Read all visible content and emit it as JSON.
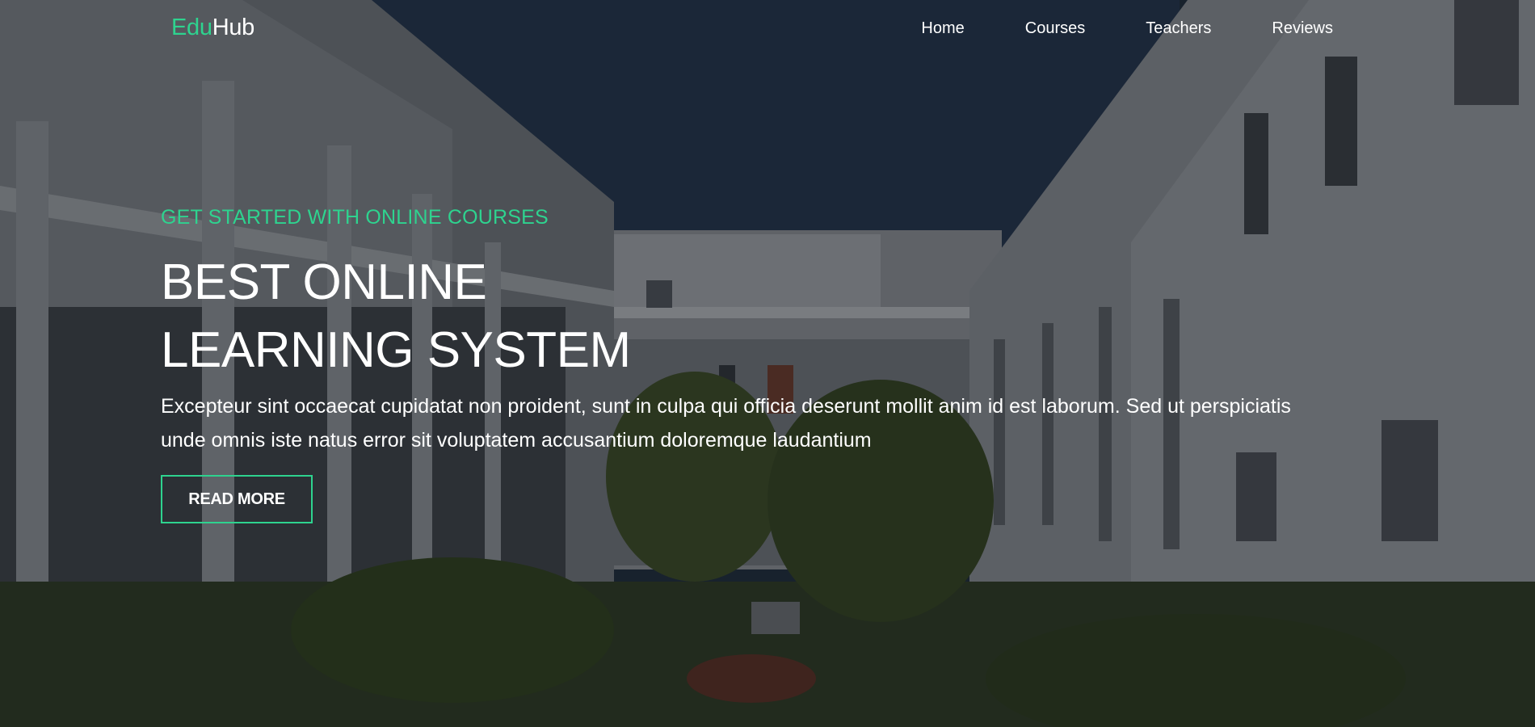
{
  "brand": {
    "logo_part1": "Edu",
    "logo_part2": "Hub",
    "accent_color": "#2ed38f"
  },
  "nav": {
    "items": [
      {
        "label": "Home"
      },
      {
        "label": "Courses"
      },
      {
        "label": "Teachers"
      },
      {
        "label": "Reviews"
      }
    ]
  },
  "hero": {
    "kicker": "GET STARTED WITH ONLINE COURSES",
    "headline_line1": "BEST ONLINE",
    "headline_line2": "LEARNING SYSTEM",
    "description": "Excepteur sint occaecat cupidatat non proident, sunt in culpa qui officia deserunt mollit anim id est laborum. Sed ut perspiciatis unde omnis iste natus error sit voluptatem accusantium doloremque laudantium",
    "button_label": "READ MORE",
    "background_image": "school-courtyard-photo"
  }
}
